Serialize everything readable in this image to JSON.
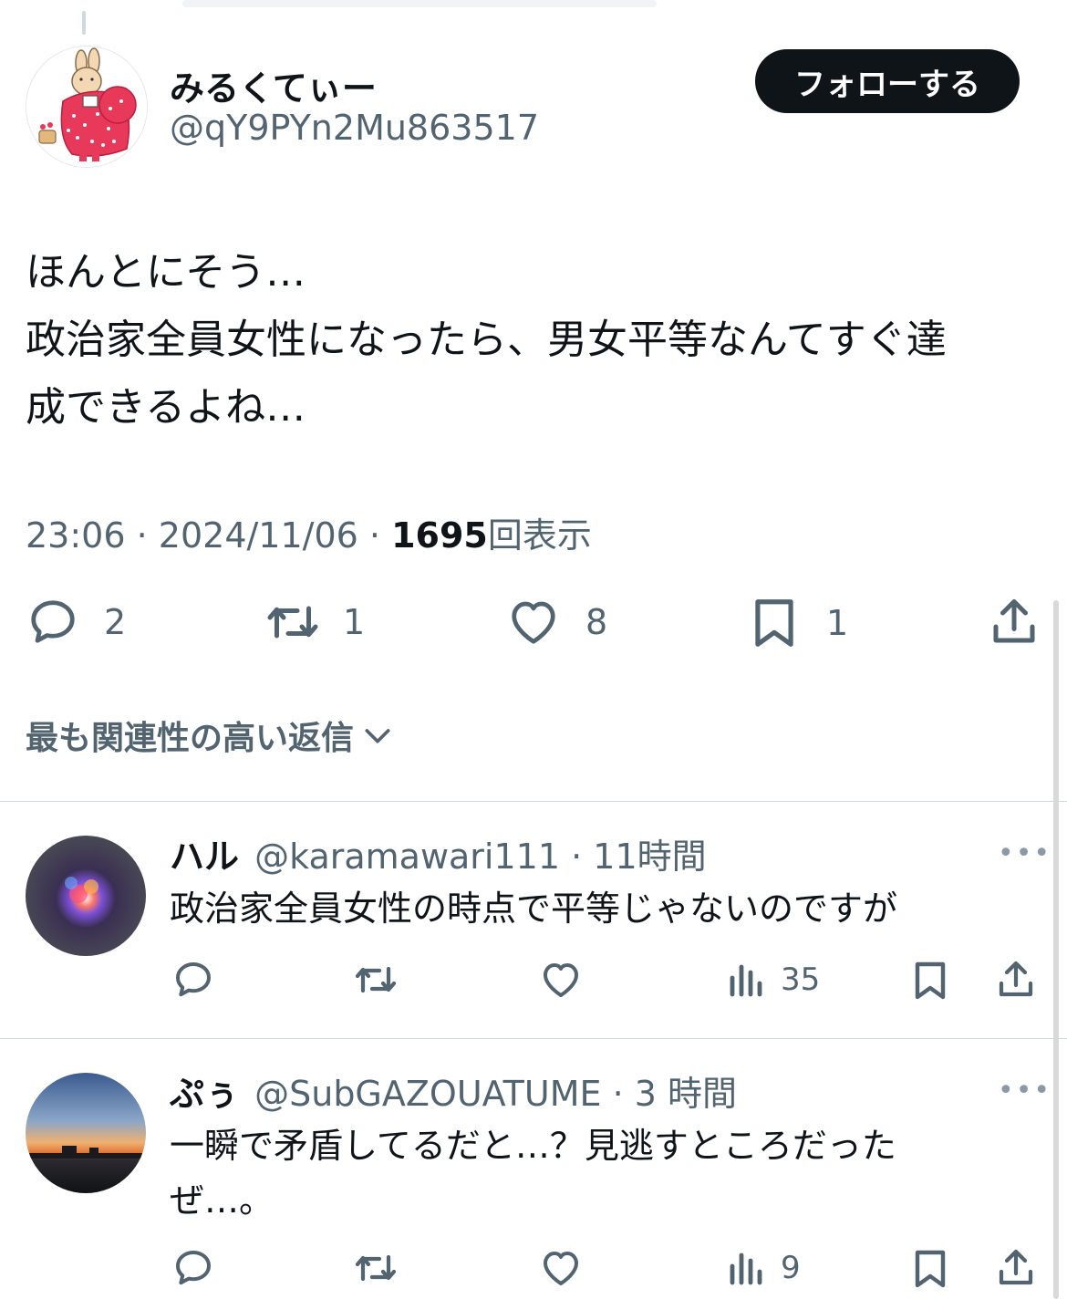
{
  "tweet": {
    "display_name": "みるくてぃー",
    "handle": "@qY9PYn2Mu863517",
    "follow_label": "フォローする",
    "text_lines": [
      "ほんとにそう…",
      "政治家全員女性になったら、男女平等なんてすぐ達",
      "成できるよね…"
    ],
    "time": "23:06",
    "date": "2024/11/06",
    "views": "1695",
    "views_label": "回表示",
    "separator": "·",
    "stats": {
      "replies": "2",
      "retweets": "1",
      "likes": "8",
      "bookmarks": "1"
    }
  },
  "sort_label": "最も関連性の高い返信",
  "replies": [
    {
      "name": "ハル",
      "handle": "@karamawari111",
      "time": "11時間",
      "text_lines": [
        "政治家全員女性の時点で平等じゃないのですが"
      ],
      "views": "35",
      "more": "•••"
    },
    {
      "name": "ぷぅ",
      "handle": "@SubGAZOUATUME",
      "time": "3 時間",
      "text_lines": [
        "一瞬で矛盾してるだと…？見逃すところだった",
        "ぜ…。"
      ],
      "views": "9",
      "more": "•••"
    }
  ],
  "icons": {
    "reply": "speech-bubble-icon",
    "retweet": "retweet-arrows-icon",
    "like": "heart-icon",
    "bookmark": "bookmark-icon",
    "share": "share-upload-icon",
    "views": "bar-chart-icon",
    "sort": "chevron-down-icon",
    "more": "ellipsis-icon"
  },
  "colors": {
    "text": "#0f1419",
    "secondary": "#536471",
    "follow_bg": "#0f1419",
    "avatar_dress": "#e8395a",
    "divider": "#cfd9de"
  }
}
